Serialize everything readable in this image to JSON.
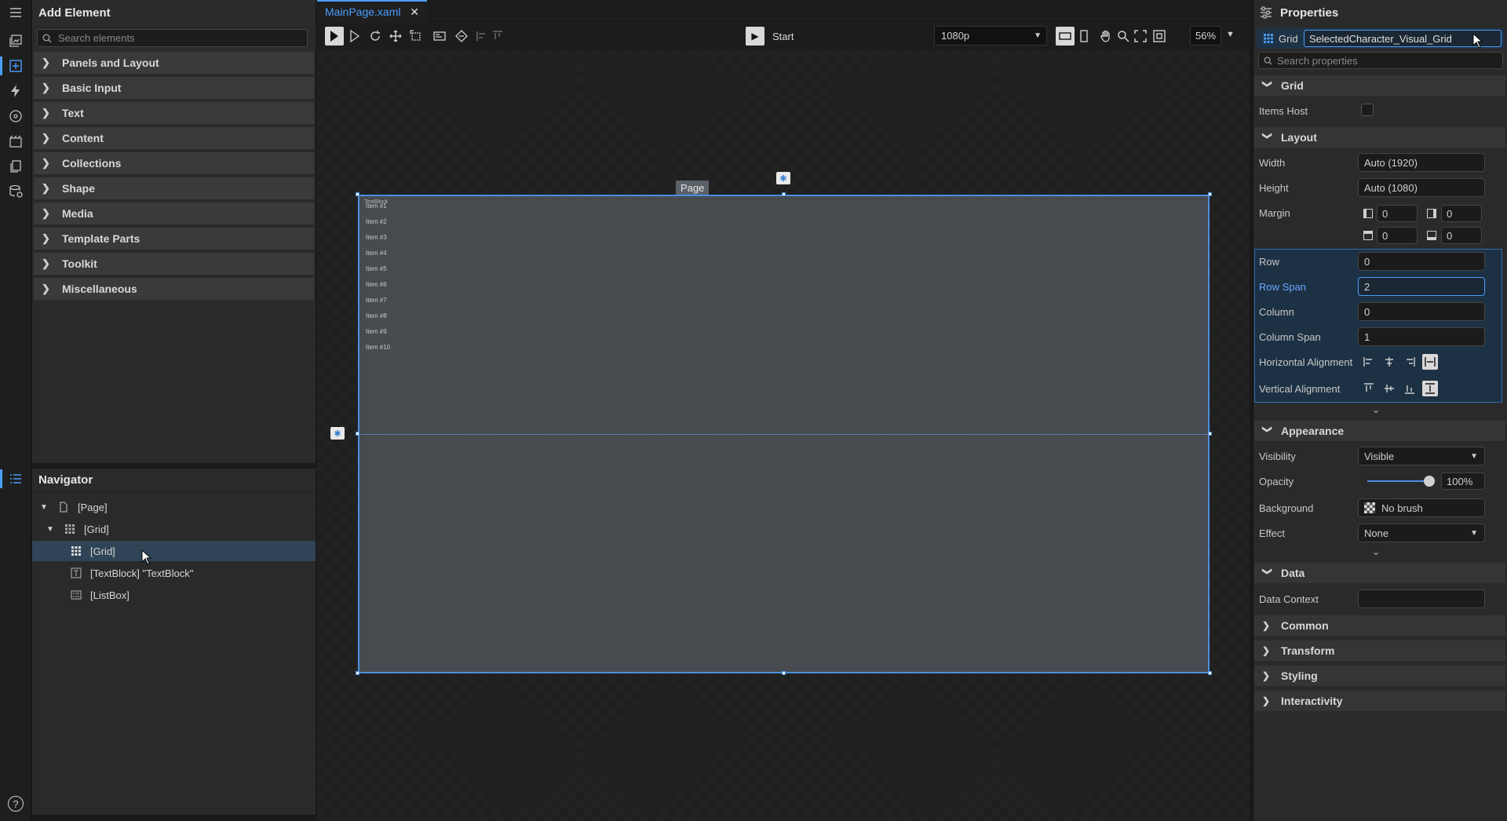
{
  "add_panel": {
    "title": "Add Element",
    "search_placeholder": "Search elements",
    "categories": [
      "Panels and Layout",
      "Basic Input",
      "Text",
      "Content",
      "Collections",
      "Shape",
      "Media",
      "Template Parts",
      "Toolkit",
      "Miscellaneous"
    ]
  },
  "navigator": {
    "title": "Navigator",
    "items": [
      "[Page]",
      "[Grid]",
      "[Grid]",
      "[TextBlock] \"TextBlock\"",
      "[ListBox]"
    ]
  },
  "editor": {
    "tab_label": "MainPage.xaml",
    "start_label": "Start",
    "resolution": "1080p",
    "zoom": "56%",
    "page_label": "Page",
    "textblock_label": "TextBlock",
    "canvas_items": [
      "Item #1",
      "Item #2",
      "Item #3",
      "Item #4",
      "Item #5",
      "Item #6",
      "Item #7",
      "Item #8",
      "Item #9",
      "Item #10"
    ]
  },
  "properties": {
    "title": "Properties",
    "element_type": "Grid",
    "element_name": "SelectedCharacter_Visual_Grid",
    "search_placeholder": "Search properties",
    "sections": {
      "grid": "Grid",
      "layout": "Layout",
      "appearance": "Appearance",
      "data": "Data",
      "common": "Common",
      "transform": "Transform",
      "styling": "Styling",
      "interactivity": "Interactivity"
    },
    "grid": {
      "items_host_label": "Items Host"
    },
    "layout": {
      "width_label": "Width",
      "width_value": "Auto (1920)",
      "height_label": "Height",
      "height_value": "Auto (1080)",
      "margin_label": "Margin",
      "margin_left": "0",
      "margin_right": "0",
      "margin_top": "0",
      "margin_bottom": "0",
      "row_label": "Row",
      "row_value": "0",
      "row_span_label": "Row Span",
      "row_span_value": "2",
      "column_label": "Column",
      "column_value": "0",
      "column_span_label": "Column Span",
      "column_span_value": "1",
      "h_align_label": "Horizontal Alignment",
      "v_align_label": "Vertical Alignment"
    },
    "appearance": {
      "visibility_label": "Visibility",
      "visibility_value": "Visible",
      "opacity_label": "Opacity",
      "opacity_value": "100%",
      "background_label": "Background",
      "background_value": "No brush",
      "effect_label": "Effect",
      "effect_value": "None"
    },
    "data": {
      "data_context_label": "Data Context",
      "data_context_value": ""
    }
  },
  "colors": {
    "accent": "#4a9eff",
    "panel": "#2a2a2a",
    "canvas": "#474b4f",
    "selection": "#2f4456"
  }
}
